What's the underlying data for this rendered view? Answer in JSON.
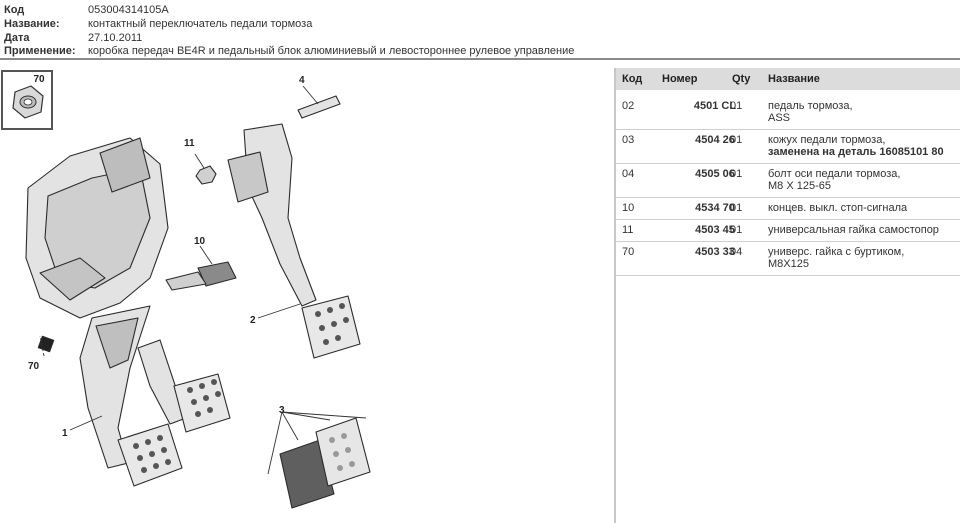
{
  "header": {
    "rows": [
      {
        "label": "Код",
        "value": "053004314105A"
      },
      {
        "label": "Название:",
        "value": "контактный переключатель педали тормоза"
      },
      {
        "label": "Дата",
        "value": "27.10.2011"
      },
      {
        "label": "Применение:",
        "value": "коробка передач BE4R и педальный блок алюминиевый и левостороннее рулевое управление"
      }
    ]
  },
  "diagram": {
    "callouts": [
      "70",
      "4",
      "11",
      "10",
      "70",
      "2",
      "3",
      "1"
    ],
    "thumbnail_label": "70"
  },
  "parts": {
    "columns": [
      "Код",
      "Номер",
      "Qty",
      "Название"
    ],
    "rows": [
      {
        "code": "02",
        "number": "4501 CL",
        "qty": "01",
        "name": "педаль тормоза,",
        "name2": "ASS",
        "name2_bold": false
      },
      {
        "code": "03",
        "number": "4504 26",
        "qty": "01",
        "name": "кожух педали тормоза,",
        "name2": "заменена на деталь 16085101 80",
        "name2_bold": true
      },
      {
        "code": "04",
        "number": "4505 06",
        "qty": "01",
        "name": "болт оси педали тормоза,",
        "name2": "M8 X 125-65",
        "name2_bold": false
      },
      {
        "code": "10",
        "number": "4534 70",
        "qty": "01",
        "name": "концев. выкл. стоп-сигнала",
        "name2": "",
        "name2_bold": false
      },
      {
        "code": "11",
        "number": "4503 45",
        "qty": "01",
        "name": "универсальная гайка самостопор",
        "name2": "",
        "name2_bold": false
      },
      {
        "code": "70",
        "number": "4503 33",
        "qty": "04",
        "name": "универс. гайка с буртиком,",
        "name2": "M8X125",
        "name2_bold": false
      }
    ]
  }
}
